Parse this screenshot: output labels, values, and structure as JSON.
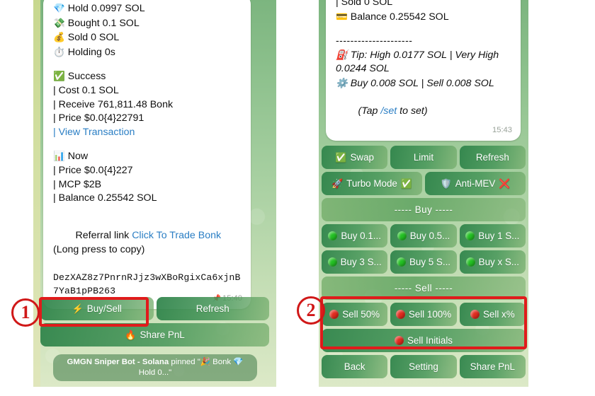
{
  "meta": {
    "app": "Telegram",
    "bot": "GMGN Sniper Bot - Solana",
    "accent_red": "#e01b1b",
    "link_blue": "#2a7ec4",
    "button_green": "#2c8248"
  },
  "panel_left": {
    "message_lines": [
      {
        "icon": "💎",
        "text": "Hold 0.0997 SOL"
      },
      {
        "icon": "💸",
        "text": "Bought 0.1 SOL"
      },
      {
        "icon": "💰",
        "text": "Sold 0 SOL"
      },
      {
        "icon": "⏱️",
        "text": "Holding 0s"
      },
      {
        "icon": "",
        "text": ""
      },
      {
        "icon": "✅",
        "text": "Success"
      },
      {
        "icon": "",
        "text": "| Cost 0.1 SOL"
      },
      {
        "icon": "",
        "text": "| Receive 761,811.48 Bonk"
      },
      {
        "icon": "",
        "text": "| Price $0.0{4}22791"
      },
      {
        "icon": "",
        "text": "| View Transaction",
        "link": true
      },
      {
        "icon": "",
        "text": ""
      },
      {
        "icon": "📊",
        "text": "Now"
      },
      {
        "icon": "",
        "text": "| Price $0.0{4}227"
      },
      {
        "icon": "",
        "text": "| MCP $2B"
      },
      {
        "icon": "",
        "text": "| Balance 0.25542 SOL"
      }
    ],
    "referral": {
      "prefix": "Referral link ",
      "link_text": "Click To Trade Bonk",
      "suffix": " (Long press to copy)"
    },
    "contract_address": "DezXAZ8z7PnrnRJjz3wXBoRgixCa6xjnB7YaB1pPB263",
    "timestamp": "15:40",
    "pin_icon": "📌",
    "keyboard": [
      [
        {
          "label": "Buy/Sell",
          "icon": "⚡",
          "dot": ""
        },
        {
          "label": "Refresh",
          "icon": "",
          "dot": ""
        }
      ],
      [
        {
          "label": "Share PnL",
          "icon": "🔥",
          "dot": "",
          "wide": true
        }
      ]
    ],
    "pinned_notice": {
      "bot_name": "GMGN Sniper Bot - Solana",
      "action": " pinned \"",
      "icon1": "🎉",
      "mid": " Bonk ",
      "icon2": "💎",
      "tail": " Hold 0...\""
    }
  },
  "panel_right": {
    "message_lines": [
      {
        "icon": "",
        "text": "| Sold 0 SOL"
      },
      {
        "icon": "💳",
        "text": "Balance 0.25542 SOL"
      },
      {
        "icon": "",
        "text": ""
      },
      {
        "icon": "",
        "text": "---------------------",
        "dashes": true
      }
    ],
    "tip_lines": [
      {
        "icon": "⛽",
        "text": "Tip: High 0.0177 SOL | Very High 0.0244 SOL"
      },
      {
        "icon": "⚙️",
        "text": "Buy 0.008 SOL | Sell 0.008 SOL"
      }
    ],
    "tap_set": {
      "prefix": "(Tap ",
      "link_text": "/set",
      "suffix": " to set)"
    },
    "timestamp": "15:43",
    "keyboard": [
      [
        {
          "label": "Swap",
          "icon": "✅",
          "dot": ""
        },
        {
          "label": "Limit",
          "icon": "",
          "dot": ""
        },
        {
          "label": "Refresh",
          "icon": "",
          "dot": ""
        }
      ],
      [
        {
          "label": "Turbo Mode",
          "icon": "🚀",
          "suffix_icon": "✅",
          "dot": ""
        },
        {
          "label": "Anti-MEV",
          "icon": "🛡️",
          "suffix_icon": "❌",
          "dot": ""
        }
      ],
      [
        {
          "label": "----- Buy -----",
          "icon": "",
          "dot": "",
          "wide": true,
          "divider": true
        }
      ],
      [
        {
          "label": "Buy 0.1...",
          "icon": "",
          "dot": "green"
        },
        {
          "label": "Buy 0.5...",
          "icon": "",
          "dot": "green"
        },
        {
          "label": "Buy 1 S...",
          "icon": "",
          "dot": "green"
        }
      ],
      [
        {
          "label": "Buy 3 S...",
          "icon": "",
          "dot": "green"
        },
        {
          "label": "Buy 5 S...",
          "icon": "",
          "dot": "green"
        },
        {
          "label": "Buy x S...",
          "icon": "",
          "dot": "green"
        }
      ],
      [
        {
          "label": "----- Sell -----",
          "icon": "",
          "dot": "",
          "wide": true,
          "divider": true
        }
      ],
      [
        {
          "label": "Sell 50%",
          "icon": "",
          "dot": "red"
        },
        {
          "label": "Sell 100%",
          "icon": "",
          "dot": "red"
        },
        {
          "label": "Sell x%",
          "icon": "",
          "dot": "red"
        }
      ],
      [
        {
          "label": "Sell Initials",
          "icon": "",
          "dot": "red",
          "wide": true
        }
      ],
      [
        {
          "label": "Back",
          "icon": "",
          "dot": ""
        },
        {
          "label": "Setting",
          "icon": "",
          "dot": ""
        },
        {
          "label": "Share PnL",
          "icon": "",
          "dot": ""
        }
      ]
    ]
  },
  "annotations": [
    {
      "number": "①",
      "plain": "1",
      "target": "buy-sell-button"
    },
    {
      "number": "②",
      "plain": "2",
      "target": "sell-buttons-group"
    }
  ]
}
